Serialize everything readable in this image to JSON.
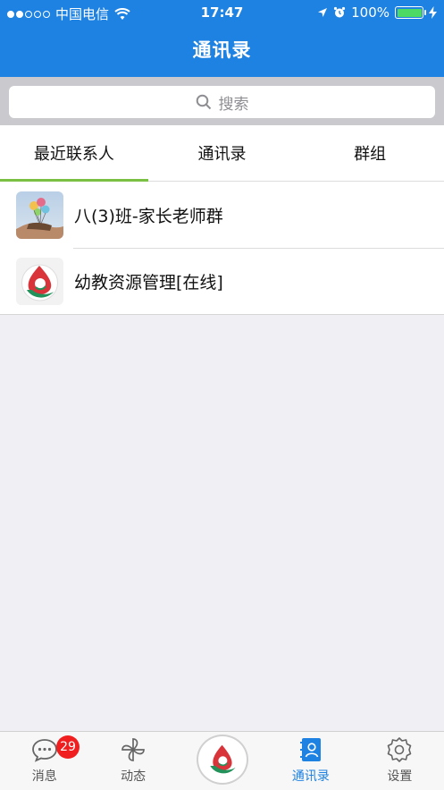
{
  "status_bar": {
    "carrier": "中国电信",
    "time": "17:47",
    "battery": "100%",
    "battery_level": 1.0
  },
  "header": {
    "title": "通讯录"
  },
  "search": {
    "placeholder": "搜索"
  },
  "tabs": [
    {
      "label": "最近联系人",
      "active": true
    },
    {
      "label": "通讯录",
      "active": false
    },
    {
      "label": "群组",
      "active": false
    }
  ],
  "contacts": [
    {
      "name": "八(3)班-家长老师群",
      "avatar_icon": "balloons-photo-avatar"
    },
    {
      "name": "幼教资源管理[在线]",
      "avatar_icon": "school-logo-avatar"
    }
  ],
  "tabbar": {
    "items": [
      {
        "label": "消息",
        "icon": "chat-bubble-icon",
        "badge": "29"
      },
      {
        "label": "动态",
        "icon": "pinwheel-icon"
      },
      {
        "label": "",
        "icon": "school-logo-icon"
      },
      {
        "label": "通讯录",
        "icon": "contacts-book-icon",
        "active": true
      },
      {
        "label": "设置",
        "icon": "gear-icon"
      }
    ]
  },
  "colors": {
    "header_bg": "#1e82e2",
    "active_tab_underline": "#7ac143",
    "badge": "#f01e1e",
    "active_tabbar": "#1e82e2"
  }
}
